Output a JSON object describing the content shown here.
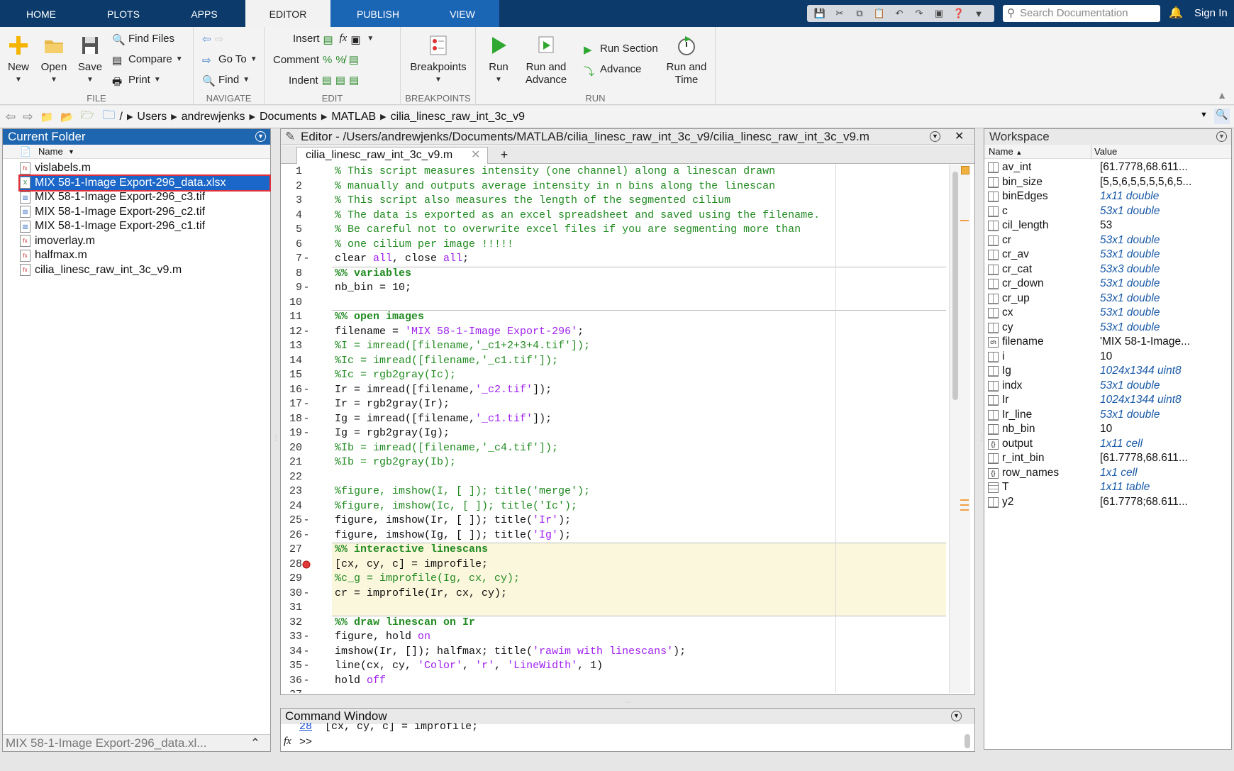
{
  "tabs": [
    "HOME",
    "PLOTS",
    "APPS",
    "EDITOR",
    "PUBLISH",
    "VIEW"
  ],
  "search": {
    "placeholder": "Search Documentation"
  },
  "signin": "Sign In",
  "toolstrip": {
    "file": {
      "label": "FILE",
      "new": "New",
      "open": "Open",
      "save": "Save",
      "find_files": "Find Files",
      "compare": "Compare",
      "print": "Print"
    },
    "navigate": {
      "label": "NAVIGATE",
      "goto": "Go To",
      "find": "Find"
    },
    "edit": {
      "label": "EDIT",
      "insert": "Insert",
      "comment": "Comment",
      "indent": "Indent"
    },
    "breakpoints": {
      "label": "BREAKPOINTS",
      "btn": "Breakpoints"
    },
    "run": {
      "label": "RUN",
      "run": "Run",
      "run_advance1": "Run and",
      "run_advance2": "Advance",
      "run_section": "Run Section",
      "advance": "Advance",
      "run_time1": "Run and",
      "run_time2": "Time"
    }
  },
  "address": {
    "root": "/",
    "crumbs": [
      "Users",
      "andrewjenks",
      "Documents",
      "MATLAB",
      "cilia_linesc_raw_int_3c_v9"
    ]
  },
  "current_folder": {
    "title": "Current Folder",
    "column": "Name",
    "files": [
      {
        "name": "vislabels.m",
        "type": "m"
      },
      {
        "name": "MIX 58-1-Image Export-296_data.xlsx",
        "type": "xlsx"
      },
      {
        "name": "MIX 58-1-Image Export-296_c3.tif",
        "type": "tif"
      },
      {
        "name": "MIX 58-1-Image Export-296_c2.tif",
        "type": "tif"
      },
      {
        "name": "MIX 58-1-Image Export-296_c1.tif",
        "type": "tif"
      },
      {
        "name": "imoverlay.m",
        "type": "m"
      },
      {
        "name": "halfmax.m",
        "type": "m"
      },
      {
        "name": "cilia_linesc_raw_int_3c_v9.m",
        "type": "m"
      }
    ],
    "footer": "MIX 58-1-Image Export-296_data.xl..."
  },
  "editor": {
    "title": "Editor - /Users/andrewjenks/Documents/MATLAB/cilia_linesc_raw_int_3c_v9/cilia_linesc_raw_int_3c_v9.m",
    "tab": "cilia_linesc_raw_int_3c_v9.m",
    "lines": [
      {
        "n": "1",
        "d": "",
        "t": [
          [
            "cm",
            "% This script measures intensity (one channel) along a linescan drawn"
          ]
        ]
      },
      {
        "n": "2",
        "d": "",
        "t": [
          [
            "cm",
            "% manually and outputs average intensity in n bins along the linescan"
          ]
        ]
      },
      {
        "n": "3",
        "d": "",
        "t": [
          [
            "cm",
            "% This script also measures the length of the segmented cilium"
          ]
        ]
      },
      {
        "n": "4",
        "d": "",
        "t": [
          [
            "cm",
            "% The data is exported as an excel spreadsheet and saved using the filename."
          ]
        ]
      },
      {
        "n": "5",
        "d": "",
        "t": [
          [
            "cm",
            "% Be careful not to overwrite excel files if you are segmenting more than"
          ]
        ]
      },
      {
        "n": "6",
        "d": "",
        "t": [
          [
            "cm",
            "% one cilium per image !!!!!"
          ]
        ]
      },
      {
        "n": "7",
        "d": "-",
        "t": [
          [
            "",
            "clear "
          ],
          [
            "str",
            "all"
          ],
          [
            "",
            ", close "
          ],
          [
            "str",
            "all"
          ],
          [
            "",
            ";"
          ]
        ]
      },
      {
        "n": "8",
        "d": "",
        "t": [
          [
            "cm b",
            "%% variables"
          ]
        ]
      },
      {
        "n": "9",
        "d": "-",
        "t": [
          [
            "",
            "nb_bin = 10;"
          ]
        ]
      },
      {
        "n": "10",
        "d": "",
        "t": []
      },
      {
        "n": "11",
        "d": "",
        "t": [
          [
            "cm b",
            "%% open images"
          ]
        ]
      },
      {
        "n": "12",
        "d": "-",
        "t": [
          [
            "",
            "filename = "
          ],
          [
            "str",
            "'MIX 58-1-Image Export-296'"
          ],
          [
            "",
            ";"
          ]
        ]
      },
      {
        "n": "13",
        "d": "",
        "t": [
          [
            "cm",
            "%I = imread([filename,'_c1+2+3+4.tif']);"
          ]
        ]
      },
      {
        "n": "14",
        "d": "",
        "t": [
          [
            "cm",
            "%Ic = imread([filename,'_c1.tif']);"
          ]
        ]
      },
      {
        "n": "15",
        "d": "",
        "t": [
          [
            "cm",
            "%Ic = rgb2gray(Ic);"
          ]
        ]
      },
      {
        "n": "16",
        "d": "-",
        "t": [
          [
            "",
            "Ir = imread([filename,"
          ],
          [
            "str",
            "'_c2.tif'"
          ],
          [
            "",
            "]);"
          ]
        ]
      },
      {
        "n": "17",
        "d": "-",
        "t": [
          [
            "",
            "Ir = rgb2gray(Ir);"
          ]
        ]
      },
      {
        "n": "18",
        "d": "-",
        "t": [
          [
            "",
            "Ig = imread([filename,"
          ],
          [
            "str",
            "'_c1.tif'"
          ],
          [
            "",
            "]);"
          ]
        ]
      },
      {
        "n": "19",
        "d": "-",
        "t": [
          [
            "",
            "Ig = rgb2gray(Ig);"
          ]
        ]
      },
      {
        "n": "20",
        "d": "",
        "t": [
          [
            "cm",
            "%Ib = imread([filename,'_c4.tif']);"
          ]
        ]
      },
      {
        "n": "21",
        "d": "",
        "t": [
          [
            "cm",
            "%Ib = rgb2gray(Ib);"
          ]
        ]
      },
      {
        "n": "22",
        "d": "",
        "t": []
      },
      {
        "n": "23",
        "d": "",
        "t": [
          [
            "cm",
            "%figure, imshow(I, [ ]); title('merge');"
          ]
        ]
      },
      {
        "n": "24",
        "d": "",
        "t": [
          [
            "cm",
            "%figure, imshow(Ic, [ ]); title('Ic');"
          ]
        ]
      },
      {
        "n": "25",
        "d": "-",
        "t": [
          [
            "",
            "figure, imshow(Ir, [ ]); title("
          ],
          [
            "str",
            "'Ir'"
          ],
          [
            "",
            ");"
          ]
        ]
      },
      {
        "n": "26",
        "d": "-",
        "t": [
          [
            "",
            "figure, imshow(Ig, [ ]); title("
          ],
          [
            "str",
            "'Ig'"
          ],
          [
            "",
            ");"
          ]
        ]
      },
      {
        "n": "27",
        "d": "",
        "t": [
          [
            "cm b",
            "%% interactive linescans"
          ]
        ]
      },
      {
        "n": "28",
        "d": "bp",
        "t": [
          [
            "",
            "[cx, cy, c] = improfile;"
          ]
        ]
      },
      {
        "n": "29",
        "d": "",
        "t": [
          [
            "cm",
            "%c_g = improfile(Ig, cx, cy);"
          ]
        ]
      },
      {
        "n": "30",
        "d": "-",
        "t": [
          [
            "",
            "cr = improfile(Ir, cx, cy);"
          ]
        ]
      },
      {
        "n": "31",
        "d": "",
        "t": []
      },
      {
        "n": "32",
        "d": "",
        "t": [
          [
            "cm b",
            "%% draw linescan on Ir"
          ]
        ]
      },
      {
        "n": "33",
        "d": "-",
        "t": [
          [
            "",
            "figure, hold "
          ],
          [
            "str",
            "on"
          ]
        ]
      },
      {
        "n": "34",
        "d": "-",
        "t": [
          [
            "",
            "imshow(Ir, []); halfmax; title("
          ],
          [
            "str",
            "'rawim with linescans'"
          ],
          [
            "",
            ");"
          ]
        ]
      },
      {
        "n": "35",
        "d": "-",
        "t": [
          [
            "",
            "line(cx, cy, "
          ],
          [
            "str",
            "'Color'"
          ],
          [
            "",
            ", "
          ],
          [
            "str",
            "'r'"
          ],
          [
            "",
            ", "
          ],
          [
            "str",
            "'LineWidth'"
          ],
          [
            "",
            ", 1)"
          ]
        ]
      },
      {
        "n": "36",
        "d": "-",
        "t": [
          [
            "",
            "hold "
          ],
          [
            "str",
            "off"
          ]
        ]
      },
      {
        "n": "37",
        "d": "",
        "t": []
      }
    ]
  },
  "workspace": {
    "title": "Workspace",
    "col_name": "Name",
    "col_value": "Value",
    "vars": [
      {
        "name": "av_int",
        "value": "[61.7778,68.611...",
        "it": false,
        "ico": "m"
      },
      {
        "name": "bin_size",
        "value": "[5,5,6,5,5,5,5,6,5...",
        "it": false,
        "ico": "m"
      },
      {
        "name": "binEdges",
        "value": "1x11 double",
        "it": true,
        "ico": "m"
      },
      {
        "name": "c",
        "value": "53x1 double",
        "it": true,
        "ico": "m"
      },
      {
        "name": "cil_length",
        "value": "53",
        "it": false,
        "ico": "m"
      },
      {
        "name": "cr",
        "value": "53x1 double",
        "it": true,
        "ico": "m"
      },
      {
        "name": "cr_av",
        "value": "53x1 double",
        "it": true,
        "ico": "m"
      },
      {
        "name": "cr_cat",
        "value": "53x3 double",
        "it": true,
        "ico": "m"
      },
      {
        "name": "cr_down",
        "value": "53x1 double",
        "it": true,
        "ico": "m"
      },
      {
        "name": "cr_up",
        "value": "53x1 double",
        "it": true,
        "ico": "m"
      },
      {
        "name": "cx",
        "value": "53x1 double",
        "it": true,
        "ico": "m"
      },
      {
        "name": "cy",
        "value": "53x1 double",
        "it": true,
        "ico": "m"
      },
      {
        "name": "filename",
        "value": "'MIX 58-1-Image...",
        "it": false,
        "ico": "ch"
      },
      {
        "name": "i",
        "value": "10",
        "it": false,
        "ico": "m"
      },
      {
        "name": "Ig",
        "value": "1024x1344 uint8",
        "it": true,
        "ico": "m"
      },
      {
        "name": "indx",
        "value": "53x1 double",
        "it": true,
        "ico": "m"
      },
      {
        "name": "Ir",
        "value": "1024x1344 uint8",
        "it": true,
        "ico": "m"
      },
      {
        "name": "Ir_line",
        "value": "53x1 double",
        "it": true,
        "ico": "m"
      },
      {
        "name": "nb_bin",
        "value": "10",
        "it": false,
        "ico": "m"
      },
      {
        "name": "output",
        "value": "1x11 cell",
        "it": true,
        "ico": "c"
      },
      {
        "name": "r_int_bin",
        "value": "[61.7778,68.611...",
        "it": false,
        "ico": "m"
      },
      {
        "name": "row_names",
        "value": "1x1 cell",
        "it": true,
        "ico": "c"
      },
      {
        "name": "T",
        "value": "1x11 table",
        "it": true,
        "ico": "t"
      },
      {
        "name": "y2",
        "value": "[61.7778;68.611...",
        "it": false,
        "ico": "m"
      }
    ]
  },
  "command": {
    "title": "Command Window",
    "prev_num": "28",
    "prev_text": "[cx, cy, c] = improfile;",
    "prompt": ">>",
    "fx": "fx"
  },
  "colors": {
    "tabbar": "#0b3a6b",
    "accent": "#1f66b0",
    "selected": "#1b66c9",
    "comment": "#228b22",
    "string": "#a020f0"
  }
}
